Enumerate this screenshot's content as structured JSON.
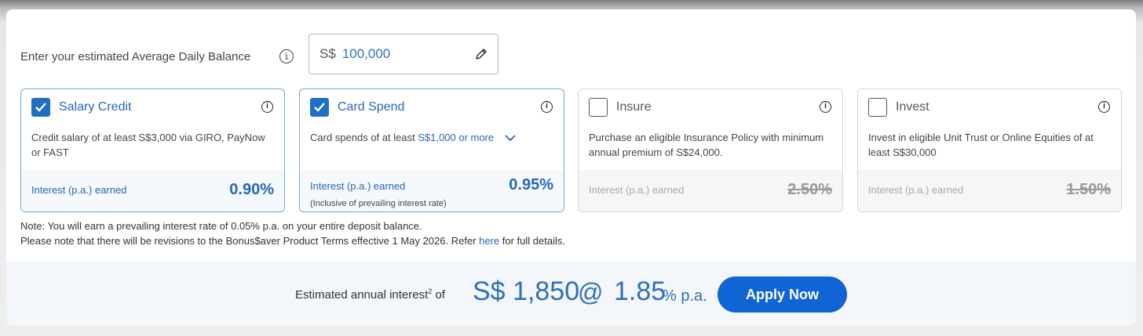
{
  "balance": {
    "label": "Enter your estimated Average Daily Balance",
    "currency": "S$",
    "value": "100,000"
  },
  "cards": [
    {
      "title": "Salary Credit",
      "checked": true,
      "description": "Credit salary of at least S$3,000 via GIRO, PayNow or FAST",
      "interest_label": "Interest (p.a.) earned",
      "rate": "0.90%"
    },
    {
      "title": "Card Spend",
      "checked": true,
      "description_prefix": "Card spends of at least",
      "description_link": "S$1,000 or more",
      "interest_label": "Interest (p.a.) earned",
      "interest_sublabel": "(Inclusive of prevailing interest rate)",
      "rate": "0.95%"
    },
    {
      "title": "Insure",
      "checked": false,
      "description": "Purchase an eligible Insurance Policy with minimum annual premium of S$24,000.",
      "interest_label": "Interest (p.a.) earned",
      "rate": "2.50%"
    },
    {
      "title": "Invest",
      "checked": false,
      "description": "Invest in eligible Unit Trust or Online Equities of at least S$30,000",
      "interest_label": "Interest (p.a.) earned",
      "rate": "1.50%"
    }
  ],
  "notes": {
    "line1": "Note: You will earn a prevailing interest rate of 0.05% p.a. on your entire deposit balance.",
    "line2_prefix": "Please note that there will be revisions to the Bonus$aver Product Terms effective  1 May 2026. Refer ",
    "line2_link": "here",
    "line2_suffix": " for full details."
  },
  "summary": {
    "label": "Estimated annual interest",
    "superscript": "2",
    "label_suffix": " of",
    "amount": "S$ 1,850",
    "at": "@",
    "rate": "1.85",
    "rate_unit": "% p.a.",
    "apply_label": "Apply Now"
  },
  "colors": {
    "accent": "#1064d3",
    "link": "#2568b8",
    "amount": "#2f73b5"
  },
  "icons": {
    "balance_info": "info-icon",
    "edit": "pencil-icon",
    "card_info": "info-icon",
    "check": "checkmark-icon",
    "expand": "chevron-down-icon"
  }
}
